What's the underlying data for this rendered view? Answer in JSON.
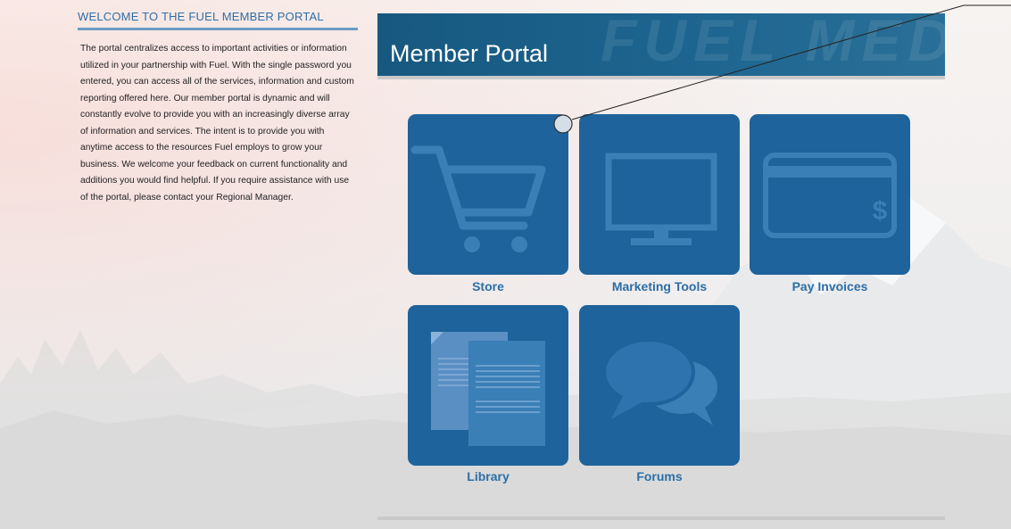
{
  "welcome": {
    "title": "WELCOME TO THE FUEL MEMBER PORTAL",
    "body": "The portal centralizes access to important activities or information utilized in your partnership with Fuel. With the single password you entered, you can access all of the services, information and custom reporting offered here. Our member portal is dynamic and will constantly evolve to provide you with an increasingly diverse array of information and services. The intent is to provide you with anytime access to the resources Fuel employs to grow your business. We welcome your feedback on current functionality and additions you would find helpful. If you require assistance with use of the portal, please contact your Regional Manager."
  },
  "banner": {
    "title": "Member Portal",
    "watermark": "FUEL MEDICAL"
  },
  "tiles": [
    {
      "label": "Store",
      "icon": "cart-icon"
    },
    {
      "label": "Marketing Tools",
      "icon": "monitor-icon"
    },
    {
      "label": "Pay Invoices",
      "icon": "credit-card-icon"
    },
    {
      "label": "Library",
      "icon": "documents-icon"
    },
    {
      "label": "Forums",
      "icon": "chat-bubbles-icon"
    }
  ],
  "colors": {
    "tile": "#1e639b",
    "tile_label": "#2d6ea6",
    "banner": "#17587f",
    "heading": "#2f6ea7"
  }
}
